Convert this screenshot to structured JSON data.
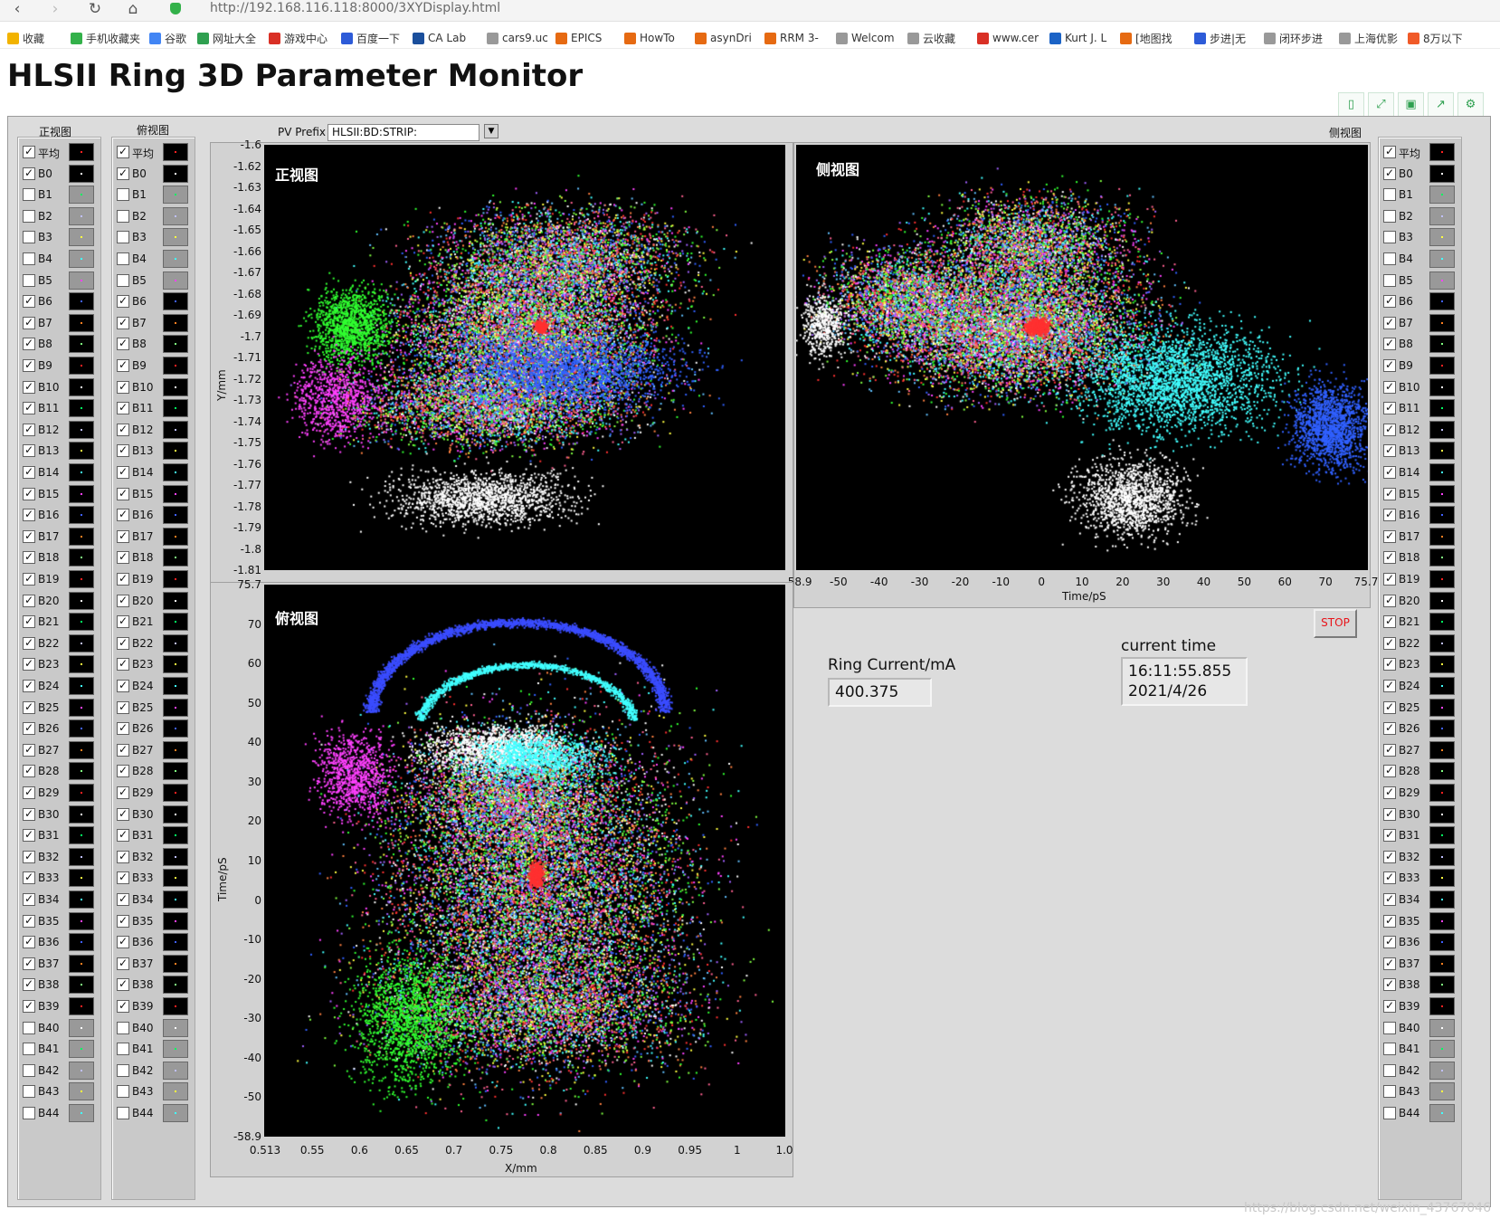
{
  "browser": {
    "url": "http://192.168.116.118:8000/3XYDisplay.html",
    "bookmarks": [
      {
        "label": "收藏",
        "color": "#f2b300"
      },
      {
        "label": "手机收藏夹",
        "color": "#33b14a"
      },
      {
        "label": "谷歌",
        "color": "#4285f4"
      },
      {
        "label": "网址大全",
        "color": "#2fa050"
      },
      {
        "label": "游戏中心",
        "color": "#d93025"
      },
      {
        "label": "百度一下",
        "color": "#2d5bd8"
      },
      {
        "label": "CA Lab",
        "color": "#1b4f9c"
      },
      {
        "label": "cars9.uc",
        "color": "#999999"
      },
      {
        "label": "EPICS",
        "color": "#e66a12"
      },
      {
        "label": "HowTo",
        "color": "#e66a12"
      },
      {
        "label": "asynDri",
        "color": "#e66a12"
      },
      {
        "label": "RRM 3-",
        "color": "#e66a12"
      },
      {
        "label": "Welcom",
        "color": "#999999"
      },
      {
        "label": "云收藏",
        "color": "#999999"
      },
      {
        "label": "www.cer",
        "color": "#d93025"
      },
      {
        "label": "Kurt J. L",
        "color": "#1b63c6"
      },
      {
        "label": "[地图找",
        "color": "#e66a12"
      },
      {
        "label": "步进|无",
        "color": "#2d5bd8"
      },
      {
        "label": "闭环步进",
        "color": "#999999"
      },
      {
        "label": "上海优影",
        "color": "#999999"
      },
      {
        "label": "8万以下",
        "color": "#f05a28"
      }
    ]
  },
  "app": {
    "title": "HLSII Ring 3D Parameter Monitor",
    "column_headers": {
      "front": "正视图",
      "top": "俯视图",
      "side": "侧视图"
    },
    "pv_prefix_label": "PV Prefix",
    "pv_prefix_value": "HLSII:BD:STRIP:",
    "ring_current_label": "Ring Current/mA",
    "ring_current_value": "400.375",
    "current_time_label": "current time",
    "current_time_line1": "16:11:55.855",
    "current_time_line2": "2021/4/26",
    "stop_label": "STOP",
    "watermark": "https://blog.csdn.net/weixin_43767046"
  },
  "checkbox_items": [
    {
      "label": "平均",
      "checked": true
    },
    {
      "label": "B0",
      "checked": true
    },
    {
      "label": "B1",
      "checked": false
    },
    {
      "label": "B2",
      "checked": false
    },
    {
      "label": "B3",
      "checked": false
    },
    {
      "label": "B4",
      "checked": false
    },
    {
      "label": "B5",
      "checked": false
    },
    {
      "label": "B6",
      "checked": true
    },
    {
      "label": "B7",
      "checked": true
    },
    {
      "label": "B8",
      "checked": true
    },
    {
      "label": "B9",
      "checked": true
    },
    {
      "label": "B10",
      "checked": true
    },
    {
      "label": "B11",
      "checked": true
    },
    {
      "label": "B12",
      "checked": true
    },
    {
      "label": "B13",
      "checked": true
    },
    {
      "label": "B14",
      "checked": true
    },
    {
      "label": "B15",
      "checked": true
    },
    {
      "label": "B16",
      "checked": true
    },
    {
      "label": "B17",
      "checked": true
    },
    {
      "label": "B18",
      "checked": true
    },
    {
      "label": "B19",
      "checked": true
    },
    {
      "label": "B20",
      "checked": true
    },
    {
      "label": "B21",
      "checked": true
    },
    {
      "label": "B22",
      "checked": true
    },
    {
      "label": "B23",
      "checked": true
    },
    {
      "label": "B24",
      "checked": true
    },
    {
      "label": "B25",
      "checked": true
    },
    {
      "label": "B26",
      "checked": true
    },
    {
      "label": "B27",
      "checked": true
    },
    {
      "label": "B28",
      "checked": true
    },
    {
      "label": "B29",
      "checked": true
    },
    {
      "label": "B30",
      "checked": true
    },
    {
      "label": "B31",
      "checked": true
    },
    {
      "label": "B32",
      "checked": true
    },
    {
      "label": "B33",
      "checked": true
    },
    {
      "label": "B34",
      "checked": true
    },
    {
      "label": "B35",
      "checked": true
    },
    {
      "label": "B36",
      "checked": true
    },
    {
      "label": "B37",
      "checked": true
    },
    {
      "label": "B38",
      "checked": true
    },
    {
      "label": "B39",
      "checked": true
    },
    {
      "label": "B40",
      "checked": false
    },
    {
      "label": "B41",
      "checked": false
    },
    {
      "label": "B42",
      "checked": false
    },
    {
      "label": "B43",
      "checked": false
    },
    {
      "label": "B44",
      "checked": false
    }
  ],
  "swatch_colors": [
    "#ff2020",
    "#ffffff",
    "#00ff60",
    "#c0c0ff",
    "#ffff40",
    "#40ffff",
    "#ff40ff",
    "#4060ff",
    "#ff8020",
    "#80ff80"
  ],
  "plots": {
    "front": {
      "title": "正视图",
      "ylabel": "Y/mm",
      "yticks": [
        "-1.6",
        "-1.62",
        "-1.63",
        "-1.64",
        "-1.65",
        "-1.66",
        "-1.67",
        "-1.68",
        "-1.69",
        "-1.7",
        "-1.71",
        "-1.72",
        "-1.73",
        "-1.74",
        "-1.75",
        "-1.76",
        "-1.77",
        "-1.78",
        "-1.79",
        "-1.8",
        "-1.81"
      ]
    },
    "side": {
      "title": "侧视图",
      "xlabel": "Time/pS",
      "xticks": [
        "-58.9",
        "-50",
        "-40",
        "-30",
        "-20",
        "-10",
        "0",
        "10",
        "20",
        "30",
        "40",
        "50",
        "60",
        "70",
        "75.7"
      ]
    },
    "top": {
      "title": "俯视图",
      "ylabel": "Time/pS",
      "xlabel": "X/mm",
      "yticks": [
        "75.7",
        "70",
        "60",
        "50",
        "40",
        "30",
        "20",
        "10",
        "0",
        "-10",
        "-20",
        "-30",
        "-40",
        "-50",
        "-58.9"
      ],
      "xticks": [
        "0.513",
        "0.55",
        "0.6",
        "0.65",
        "0.7",
        "0.75",
        "0.8",
        "0.85",
        "0.9",
        "0.95",
        "1",
        "1.0"
      ]
    }
  },
  "scatter_palette": [
    "#ff3030",
    "#30ff30",
    "#3060ff",
    "#ffff40",
    "#40ffff",
    "#ff40ff",
    "#ffffff",
    "#ff8040",
    "#80ff40",
    "#a060ff",
    "#ff6090",
    "#60c0ff"
  ]
}
